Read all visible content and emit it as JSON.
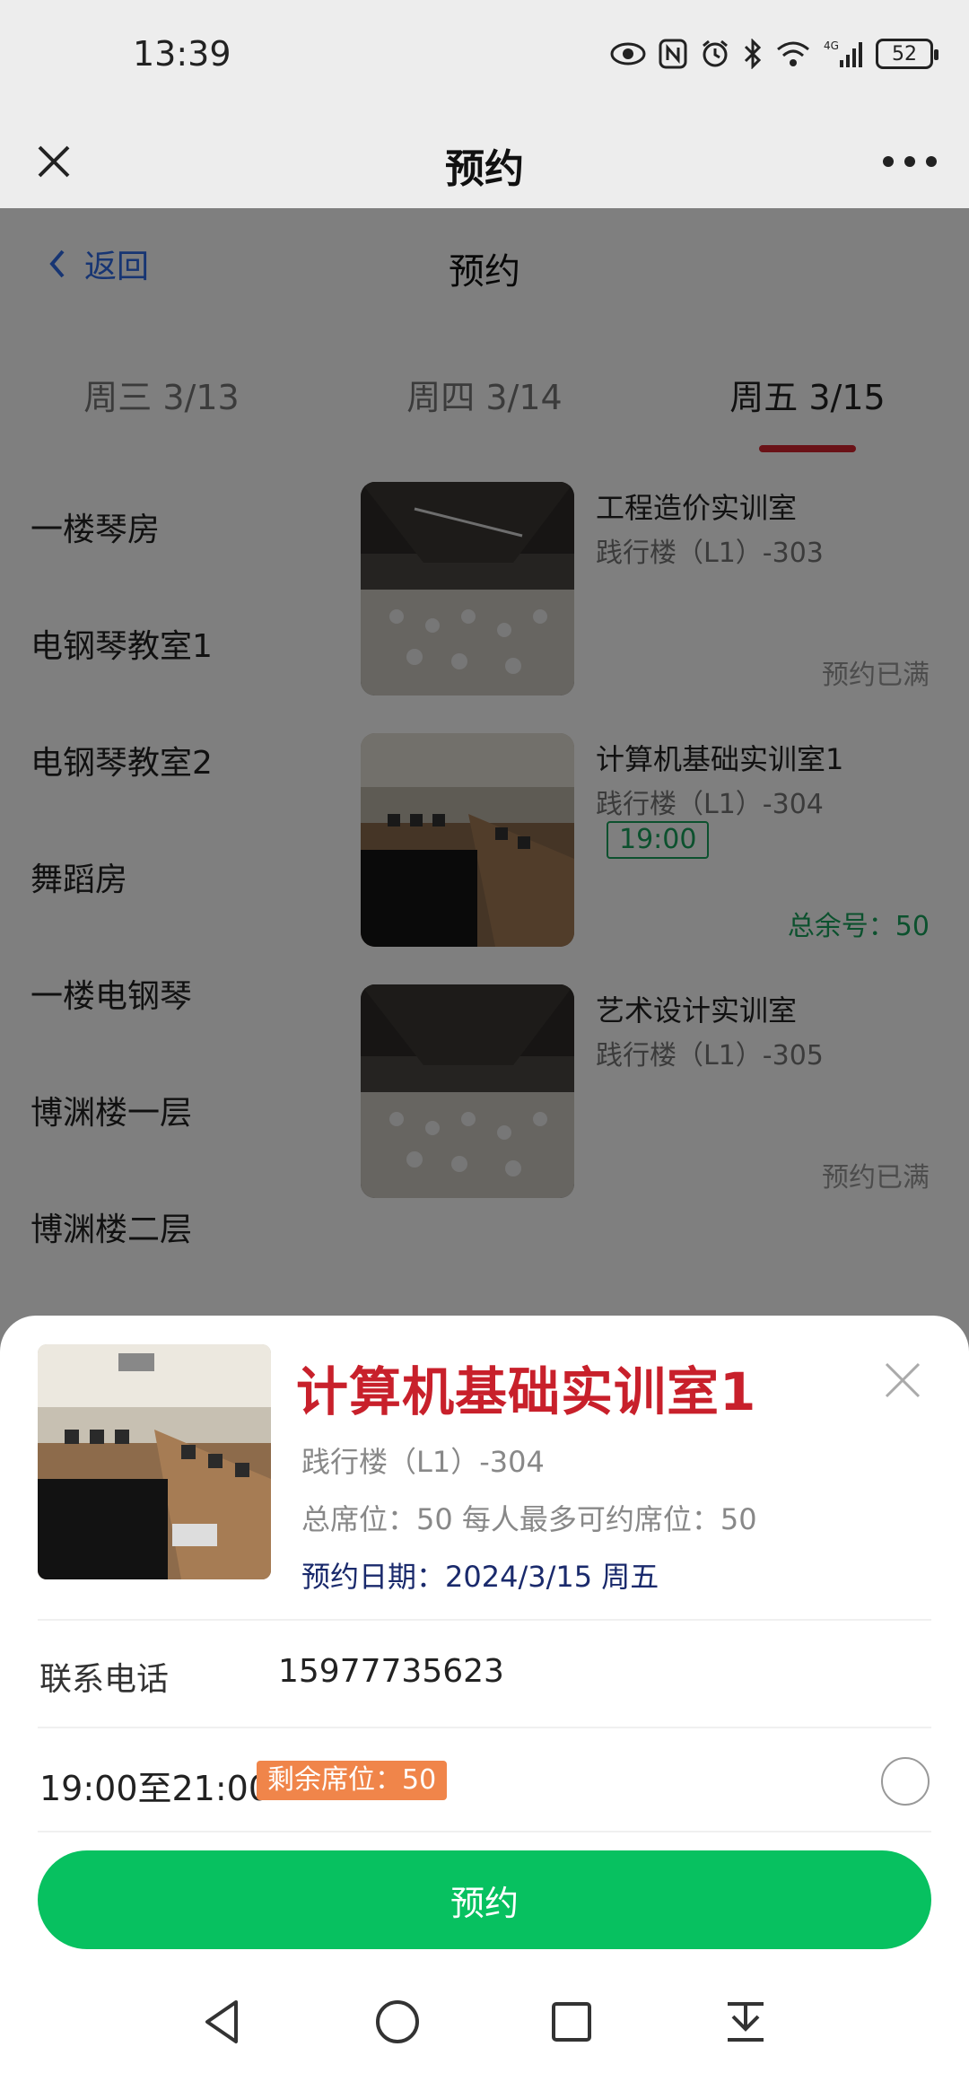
{
  "status_bar": {
    "time": "13:39",
    "network": "4G",
    "battery": "52",
    "icons": [
      "eye-icon",
      "nfc-icon",
      "alarm-icon",
      "bluetooth-icon",
      "wifi-icon",
      "signal-icon",
      "battery-icon"
    ]
  },
  "wechat_header": {
    "title": "预约",
    "close_icon": "close-icon",
    "more_icon": "more-icon"
  },
  "page": {
    "back_label": "返回",
    "title": "预约",
    "date_tabs": [
      {
        "label": "周三 3/13",
        "active": false
      },
      {
        "label": "周四 3/14",
        "active": false
      },
      {
        "label": "周五 3/15",
        "active": true
      }
    ],
    "sidebar": [
      "一楼琴房",
      "电钢琴教室1",
      "电钢琴教室2",
      "舞蹈房",
      "一楼电钢琴",
      "博渊楼一层",
      "博渊楼二层"
    ],
    "rooms": [
      {
        "name": "工程造价实训室",
        "location": "践行楼（L1）-303",
        "slot": "",
        "status": "预约已满"
      },
      {
        "name": "计算机基础实训室1",
        "location": "践行楼（L1）-304",
        "slot": "19:00",
        "status": "总余号：50"
      },
      {
        "name": "艺术设计实训室",
        "location": "践行楼（L1）-305",
        "slot": "",
        "status": "预约已满"
      }
    ]
  },
  "sheet": {
    "title": "计算机基础实训室1",
    "location": "践行楼（L1）-304",
    "seats": "总席位：50 每人最多可约席位：50",
    "date": "预约日期：2024/3/15 周五",
    "phone_label": "联系电话",
    "phone_value": "15977735623",
    "slot_text": "19:00至21:00",
    "slot_badge": "剩余席位：50",
    "reserve_button": "预约"
  },
  "colors": {
    "accent_red": "#c8202b",
    "tab_underline": "#d4242f",
    "green": "#07c160",
    "badge_orange": "#f0854a",
    "link_blue": "#2e6be6"
  },
  "nav_bar": [
    "back-triangle-icon",
    "home-circle-icon",
    "recents-square-icon",
    "notification-pull-icon"
  ]
}
